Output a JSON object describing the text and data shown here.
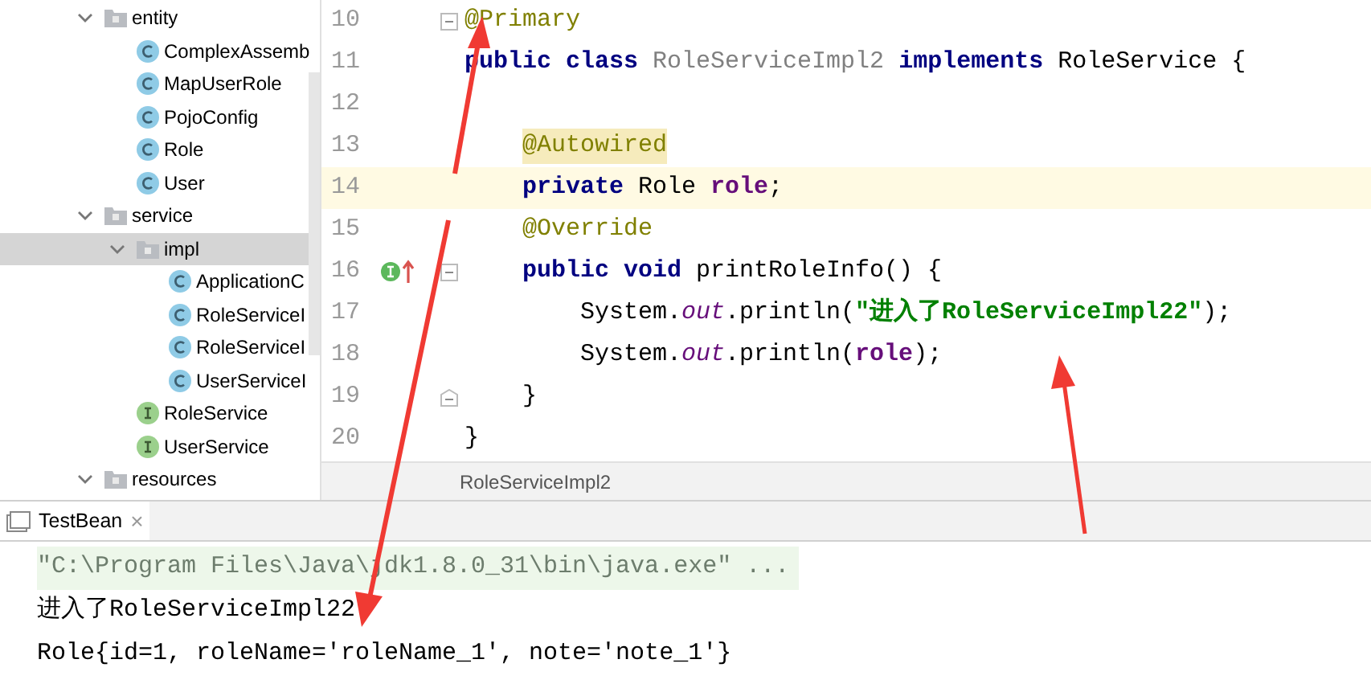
{
  "project_tree": [
    {
      "kind": "folder",
      "label": "entity",
      "expanded": true,
      "selected": false,
      "children": [
        {
          "kind": "class",
          "label": "ComplexAssemb",
          "selected": false
        },
        {
          "kind": "class",
          "label": "MapUserRole",
          "selected": false
        },
        {
          "kind": "class",
          "label": "PojoConfig",
          "selected": false
        },
        {
          "kind": "class",
          "label": "Role",
          "selected": false
        },
        {
          "kind": "class",
          "label": "User",
          "selected": false
        }
      ]
    },
    {
      "kind": "folder",
      "label": "service",
      "expanded": true,
      "selected": false,
      "children": [
        {
          "kind": "folder",
          "label": "impl",
          "expanded": true,
          "selected": true,
          "children": [
            {
              "kind": "class",
              "label": "ApplicationC",
              "selected": false
            },
            {
              "kind": "class",
              "label": "RoleServiceI",
              "selected": false
            },
            {
              "kind": "class",
              "label": "RoleServiceI",
              "selected": false
            },
            {
              "kind": "class",
              "label": "UserServiceI",
              "selected": false
            }
          ]
        },
        {
          "kind": "interface",
          "label": "RoleService",
          "selected": false
        },
        {
          "kind": "interface",
          "label": "UserService",
          "selected": false
        }
      ]
    },
    {
      "kind": "folder",
      "label": "resources",
      "expanded": true,
      "selected": false
    }
  ],
  "editor": {
    "lines": [
      {
        "number": "10",
        "current": false,
        "fold_start": true,
        "tokens": [
          {
            "kind": "annotation",
            "text": "@Primary"
          }
        ]
      },
      {
        "number": "11",
        "current": false,
        "tokens": [
          {
            "kind": "keyword",
            "text": "public"
          },
          {
            "kind": "keyword",
            "text": " class"
          },
          {
            "kind": "unused",
            "text": " RoleServiceImpl2"
          },
          {
            "kind": "keyword",
            "text": " implements"
          },
          {
            "kind": "plain",
            "text": " RoleService {"
          }
        ],
        "children": [
          {
            "number": "12",
            "current": false
          },
          {
            "number": "13",
            "current": false,
            "tokens": [
              {
                "kind": "annotation_marked",
                "text": "@Autowired"
              }
            ]
          },
          {
            "number": "14",
            "current": true,
            "tokens": [
              {
                "kind": "keyword",
                "text": "private"
              },
              {
                "kind": "plain",
                "text": " Role "
              },
              {
                "kind": "field",
                "text": "role"
              },
              {
                "kind": "plain",
                "text": ";"
              }
            ]
          },
          {
            "number": "15",
            "current": false,
            "tokens": [
              {
                "kind": "annotation",
                "text": "@Override"
              }
            ]
          },
          {
            "number": "16",
            "current": false,
            "fold_start": true,
            "implements_marker": true,
            "tokens": [
              {
                "kind": "keyword",
                "text": "public"
              },
              {
                "kind": "keyword",
                "text": " void"
              },
              {
                "kind": "plain",
                "text": " printRoleInfo() {"
              }
            ],
            "children": [
              {
                "number": "17",
                "current": false,
                "tokens": [
                  {
                    "kind": "plain",
                    "text": "System."
                  },
                  {
                    "kind": "static",
                    "text": "out"
                  },
                  {
                    "kind": "plain",
                    "text": ".println("
                  },
                  {
                    "kind": "string",
                    "text": "\"进入了RoleServiceImpl22\""
                  },
                  {
                    "kind": "plain",
                    "text": ");"
                  }
                ]
              },
              {
                "number": "18",
                "current": false,
                "tokens": [
                  {
                    "kind": "plain",
                    "text": "System."
                  },
                  {
                    "kind": "static",
                    "text": "out"
                  },
                  {
                    "kind": "plain",
                    "text": ".println("
                  },
                  {
                    "kind": "field",
                    "text": "role"
                  },
                  {
                    "kind": "plain",
                    "text": ");"
                  }
                ]
              }
            ]
          },
          {
            "number": "19",
            "current": false,
            "fold_end": true,
            "tokens": [
              {
                "kind": "plain",
                "text": "}"
              }
            ]
          }
        ]
      },
      {
        "number": "20",
        "current": false,
        "tokens": [
          {
            "kind": "plain",
            "text": "}"
          }
        ]
      }
    ],
    "breadcrumb": "RoleServiceImpl2"
  },
  "run_panel": {
    "tab": {
      "label": "TestBean",
      "close": "×",
      "selected": true
    },
    "console": [
      {
        "kind": "command",
        "text": "\"C:\\Program Files\\Java\\jdk1.8.0_31\\bin\\java.exe\" ..."
      },
      {
        "kind": "output",
        "text": "进入了RoleServiceImpl22"
      },
      {
        "kind": "output",
        "text": "Role{id=1, roleName='roleName_1', note='note_1'}"
      }
    ]
  }
}
